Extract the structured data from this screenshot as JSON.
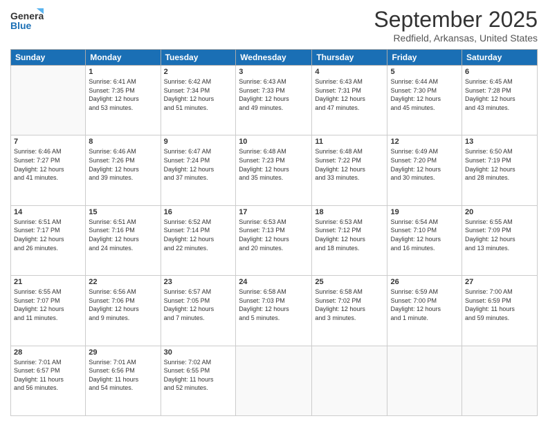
{
  "header": {
    "logo_general": "General",
    "logo_blue": "Blue",
    "month": "September 2025",
    "location": "Redfield, Arkansas, United States"
  },
  "weekdays": [
    "Sunday",
    "Monday",
    "Tuesday",
    "Wednesday",
    "Thursday",
    "Friday",
    "Saturday"
  ],
  "weeks": [
    [
      {
        "day": "",
        "info": ""
      },
      {
        "day": "1",
        "info": "Sunrise: 6:41 AM\nSunset: 7:35 PM\nDaylight: 12 hours\nand 53 minutes."
      },
      {
        "day": "2",
        "info": "Sunrise: 6:42 AM\nSunset: 7:34 PM\nDaylight: 12 hours\nand 51 minutes."
      },
      {
        "day": "3",
        "info": "Sunrise: 6:43 AM\nSunset: 7:33 PM\nDaylight: 12 hours\nand 49 minutes."
      },
      {
        "day": "4",
        "info": "Sunrise: 6:43 AM\nSunset: 7:31 PM\nDaylight: 12 hours\nand 47 minutes."
      },
      {
        "day": "5",
        "info": "Sunrise: 6:44 AM\nSunset: 7:30 PM\nDaylight: 12 hours\nand 45 minutes."
      },
      {
        "day": "6",
        "info": "Sunrise: 6:45 AM\nSunset: 7:28 PM\nDaylight: 12 hours\nand 43 minutes."
      }
    ],
    [
      {
        "day": "7",
        "info": "Sunrise: 6:46 AM\nSunset: 7:27 PM\nDaylight: 12 hours\nand 41 minutes."
      },
      {
        "day": "8",
        "info": "Sunrise: 6:46 AM\nSunset: 7:26 PM\nDaylight: 12 hours\nand 39 minutes."
      },
      {
        "day": "9",
        "info": "Sunrise: 6:47 AM\nSunset: 7:24 PM\nDaylight: 12 hours\nand 37 minutes."
      },
      {
        "day": "10",
        "info": "Sunrise: 6:48 AM\nSunset: 7:23 PM\nDaylight: 12 hours\nand 35 minutes."
      },
      {
        "day": "11",
        "info": "Sunrise: 6:48 AM\nSunset: 7:22 PM\nDaylight: 12 hours\nand 33 minutes."
      },
      {
        "day": "12",
        "info": "Sunrise: 6:49 AM\nSunset: 7:20 PM\nDaylight: 12 hours\nand 30 minutes."
      },
      {
        "day": "13",
        "info": "Sunrise: 6:50 AM\nSunset: 7:19 PM\nDaylight: 12 hours\nand 28 minutes."
      }
    ],
    [
      {
        "day": "14",
        "info": "Sunrise: 6:51 AM\nSunset: 7:17 PM\nDaylight: 12 hours\nand 26 minutes."
      },
      {
        "day": "15",
        "info": "Sunrise: 6:51 AM\nSunset: 7:16 PM\nDaylight: 12 hours\nand 24 minutes."
      },
      {
        "day": "16",
        "info": "Sunrise: 6:52 AM\nSunset: 7:14 PM\nDaylight: 12 hours\nand 22 minutes."
      },
      {
        "day": "17",
        "info": "Sunrise: 6:53 AM\nSunset: 7:13 PM\nDaylight: 12 hours\nand 20 minutes."
      },
      {
        "day": "18",
        "info": "Sunrise: 6:53 AM\nSunset: 7:12 PM\nDaylight: 12 hours\nand 18 minutes."
      },
      {
        "day": "19",
        "info": "Sunrise: 6:54 AM\nSunset: 7:10 PM\nDaylight: 12 hours\nand 16 minutes."
      },
      {
        "day": "20",
        "info": "Sunrise: 6:55 AM\nSunset: 7:09 PM\nDaylight: 12 hours\nand 13 minutes."
      }
    ],
    [
      {
        "day": "21",
        "info": "Sunrise: 6:55 AM\nSunset: 7:07 PM\nDaylight: 12 hours\nand 11 minutes."
      },
      {
        "day": "22",
        "info": "Sunrise: 6:56 AM\nSunset: 7:06 PM\nDaylight: 12 hours\nand 9 minutes."
      },
      {
        "day": "23",
        "info": "Sunrise: 6:57 AM\nSunset: 7:05 PM\nDaylight: 12 hours\nand 7 minutes."
      },
      {
        "day": "24",
        "info": "Sunrise: 6:58 AM\nSunset: 7:03 PM\nDaylight: 12 hours\nand 5 minutes."
      },
      {
        "day": "25",
        "info": "Sunrise: 6:58 AM\nSunset: 7:02 PM\nDaylight: 12 hours\nand 3 minutes."
      },
      {
        "day": "26",
        "info": "Sunrise: 6:59 AM\nSunset: 7:00 PM\nDaylight: 12 hours\nand 1 minute."
      },
      {
        "day": "27",
        "info": "Sunrise: 7:00 AM\nSunset: 6:59 PM\nDaylight: 11 hours\nand 59 minutes."
      }
    ],
    [
      {
        "day": "28",
        "info": "Sunrise: 7:01 AM\nSunset: 6:57 PM\nDaylight: 11 hours\nand 56 minutes."
      },
      {
        "day": "29",
        "info": "Sunrise: 7:01 AM\nSunset: 6:56 PM\nDaylight: 11 hours\nand 54 minutes."
      },
      {
        "day": "30",
        "info": "Sunrise: 7:02 AM\nSunset: 6:55 PM\nDaylight: 11 hours\nand 52 minutes."
      },
      {
        "day": "",
        "info": ""
      },
      {
        "day": "",
        "info": ""
      },
      {
        "day": "",
        "info": ""
      },
      {
        "day": "",
        "info": ""
      }
    ]
  ]
}
